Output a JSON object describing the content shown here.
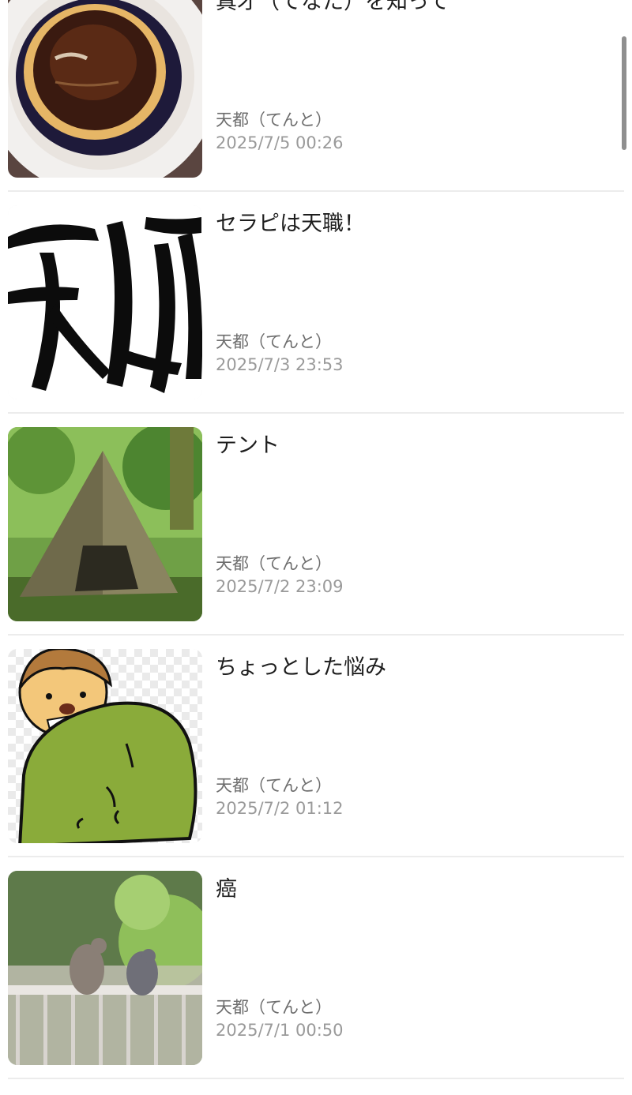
{
  "posts": [
    {
      "title": "真才（てなた）を知って",
      "author": "天都（てんと）",
      "date": "2025/7/5 00:26",
      "thumb_icon": "pudding-photo"
    },
    {
      "title": "セラピは天職！",
      "author": "天都（てんと）",
      "date": "2025/7/3 23:53",
      "thumb_icon": "calligraphy-image"
    },
    {
      "title": "テント",
      "author": "天都（てんと）",
      "date": "2025/7/2 23:09",
      "thumb_icon": "tent-photo"
    },
    {
      "title": "ちょっとした悩み",
      "author": "天都（てんと）",
      "date": "2025/7/2 01:12",
      "thumb_icon": "cartoon-illustration"
    },
    {
      "title": "癌",
      "author": "天都（てんと）",
      "date": "2025/7/1 00:50",
      "thumb_icon": "doves-photo"
    }
  ],
  "colors": {
    "divider": "#ececec",
    "title": "#1e1e1e",
    "author": "#6e6e6e",
    "date": "#9a9a9a"
  }
}
